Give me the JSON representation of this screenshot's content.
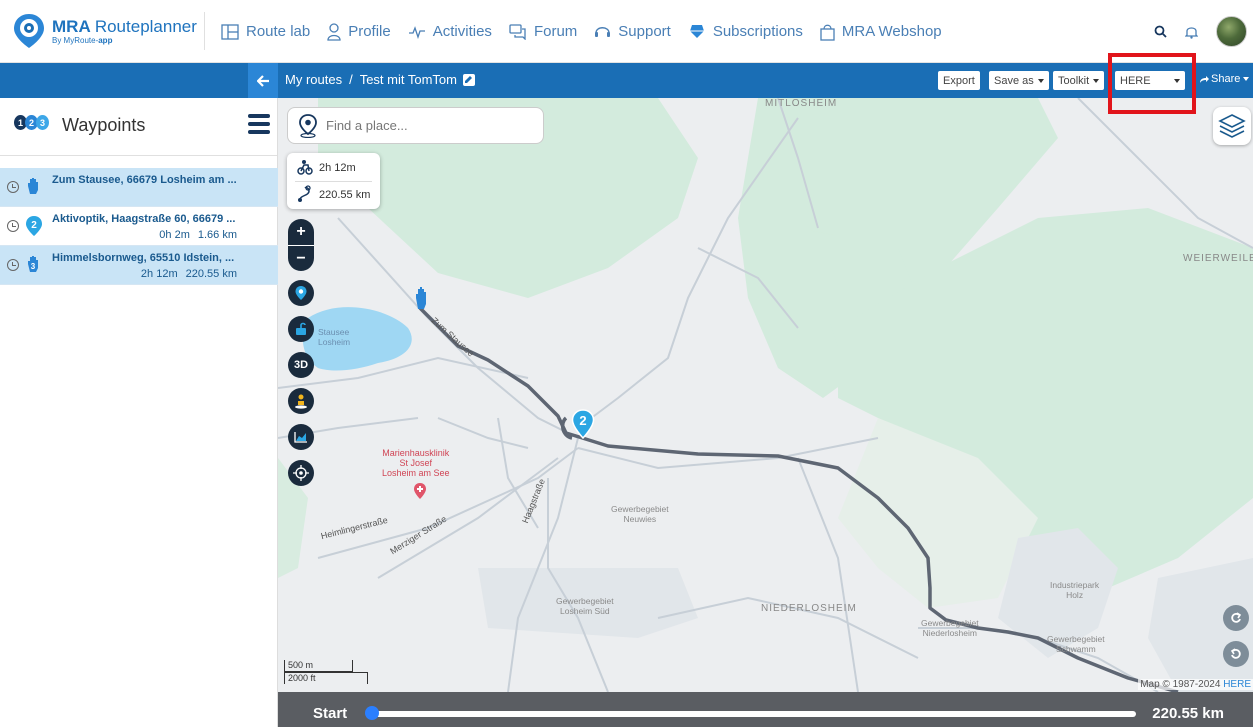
{
  "app": {
    "logo_title_bold": "MRA",
    "logo_title_rest": "Routeplanner",
    "logo_sub_prefix": "By MyRoute-",
    "logo_sub_app": "app"
  },
  "nav": {
    "items": [
      {
        "label": "Route lab",
        "icon": "route-lab-icon"
      },
      {
        "label": "Profile",
        "icon": "profile-icon"
      },
      {
        "label": "Activities",
        "icon": "activities-icon"
      },
      {
        "label": "Forum",
        "icon": "forum-icon"
      },
      {
        "label": "Support",
        "icon": "support-icon"
      },
      {
        "label": "Subscriptions",
        "icon": "subscriptions-icon"
      },
      {
        "label": "MRA Webshop",
        "icon": "webshop-icon"
      }
    ]
  },
  "toolbar": {
    "breadcrumb_root": "My routes",
    "breadcrumb_sep": "/",
    "route_name": "Test mit TomTom",
    "export_label": "Export",
    "save_as_label": "Save as",
    "toolkit_label": "Toolkit",
    "map_provider_value": "HERE",
    "share_label": "Share"
  },
  "sidebar": {
    "title": "Waypoints",
    "badges": [
      "1",
      "2",
      "3"
    ],
    "waypoints": [
      {
        "name": "Zum Stausee, 66679 Losheim am ...",
        "time": "",
        "distance": "",
        "selected": true,
        "marker": "hand"
      },
      {
        "name": "Aktivoptik, Haagstraße 60, 66679 ...",
        "time": "0h 2m",
        "distance": "1.66 km",
        "selected": false,
        "marker": "2"
      },
      {
        "name": "Himmelsbornweg, 65510 Idstein, ...",
        "time": "2h 12m",
        "distance": "220.55 km",
        "selected": true,
        "marker": "3"
      }
    ]
  },
  "map": {
    "search_placeholder": "Find a place...",
    "summary_time": "2h 12m",
    "summary_distance": "220.55 km",
    "button_3d": "3D",
    "route_marker": "2",
    "scale_metric": "500 m",
    "scale_imperial": "2000 ft",
    "copyright_prefix": "Map © 1987-2024",
    "copyright_brand": "HERE",
    "labels": {
      "mitlosheim": "MITLOSHEIM",
      "weierweiler": "WEIERWEILE",
      "niederlosheim": "NIEDERLOSHEIM",
      "stausee": "Stausee\nLosheim",
      "hospital": "Marienhausklinik\nSt Josef\nLosheim am See",
      "gew_neuwies": "Gewerbegebiet\nNeuwies",
      "gew_sued": "Gewerbegebiet\nLosheim Süd",
      "gew_nieder": "Gewerbegebiet\nNiederlosheim",
      "gew_schwamm": "Gewerbegebiet\nSchwamm",
      "industriepark": "Industriepark\nHolz",
      "zum_stausee": "Zum Stausee",
      "haagstrasse": "Haagstraße",
      "heimlingerstrasse": "Heimlingerstraße",
      "merziger": "Merziger Straße"
    }
  },
  "bottom": {
    "start_label": "Start",
    "total_distance": "220.55 km",
    "progress": 0
  },
  "colors": {
    "primary": "#1a6eb5",
    "accent": "#2b86d6",
    "highlight": "#e1141b",
    "route": "#5e6673"
  }
}
